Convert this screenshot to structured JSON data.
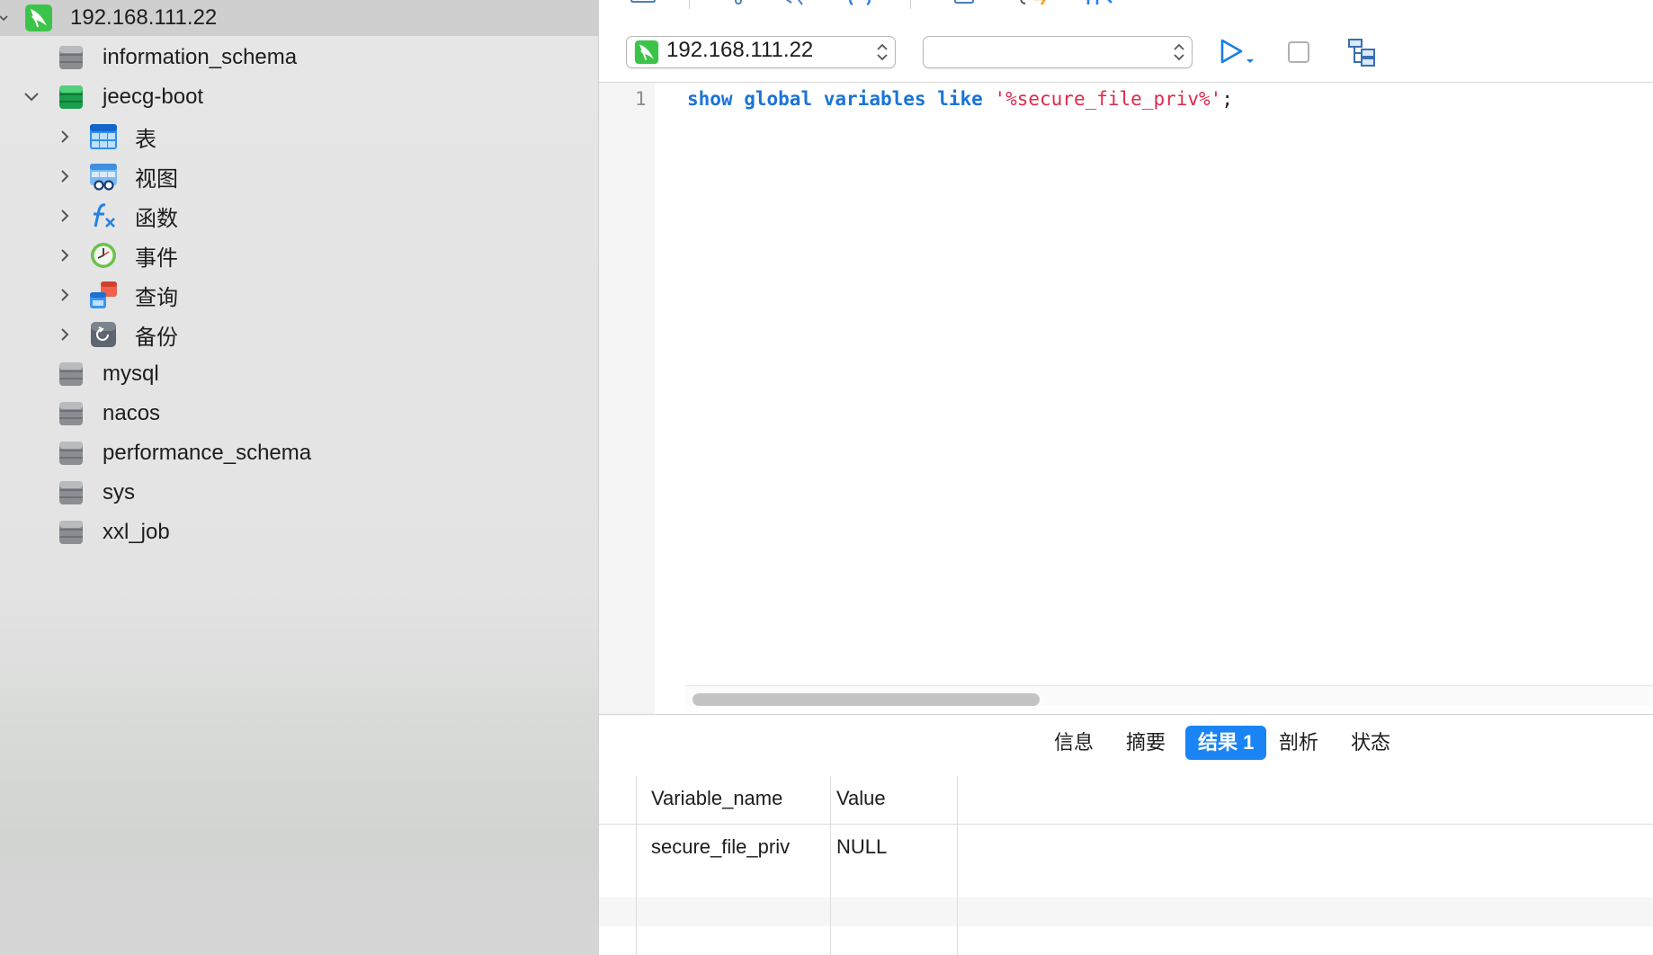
{
  "sidebar": {
    "connection": {
      "label": "192.168.111.22"
    },
    "databases": [
      {
        "label": "information_schema"
      },
      {
        "label": "jeecg-boot"
      },
      {
        "label": "mysql"
      },
      {
        "label": "nacos"
      },
      {
        "label": "performance_schema"
      },
      {
        "label": "sys"
      },
      {
        "label": "xxl_job"
      }
    ],
    "objects": [
      {
        "label": "表",
        "icon": "table-icon"
      },
      {
        "label": "视图",
        "icon": "view-icon"
      },
      {
        "label": "函数",
        "icon": "function-icon"
      },
      {
        "label": "事件",
        "icon": "event-clock-icon"
      },
      {
        "label": "查询",
        "icon": "query-icon"
      },
      {
        "label": "备份",
        "icon": "backup-icon"
      }
    ]
  },
  "toolbar": {
    "connection_value": "192.168.111.22",
    "database_value": ""
  },
  "editor": {
    "line_number": "1",
    "code": {
      "k1": "show",
      "k2": "global",
      "k3": "variables",
      "k4": "like",
      "s1": "'%secure_file_priv%'",
      "p1": ";"
    }
  },
  "results_tabs": [
    {
      "label": "信息"
    },
    {
      "label": "摘要"
    },
    {
      "label": "结果 1"
    },
    {
      "label": "剖析"
    },
    {
      "label": "状态"
    }
  ],
  "active_tab_index": 2,
  "grid": {
    "columns": [
      "Variable_name",
      "Value"
    ],
    "rows": [
      [
        "secure_file_priv",
        "NULL"
      ]
    ]
  },
  "colors": {
    "accent": "#1a84f5",
    "keyword": "#1a73d9",
    "string": "#e2284b",
    "mysql_green": "#3cc44a",
    "db_green": "#1a9e4b"
  }
}
